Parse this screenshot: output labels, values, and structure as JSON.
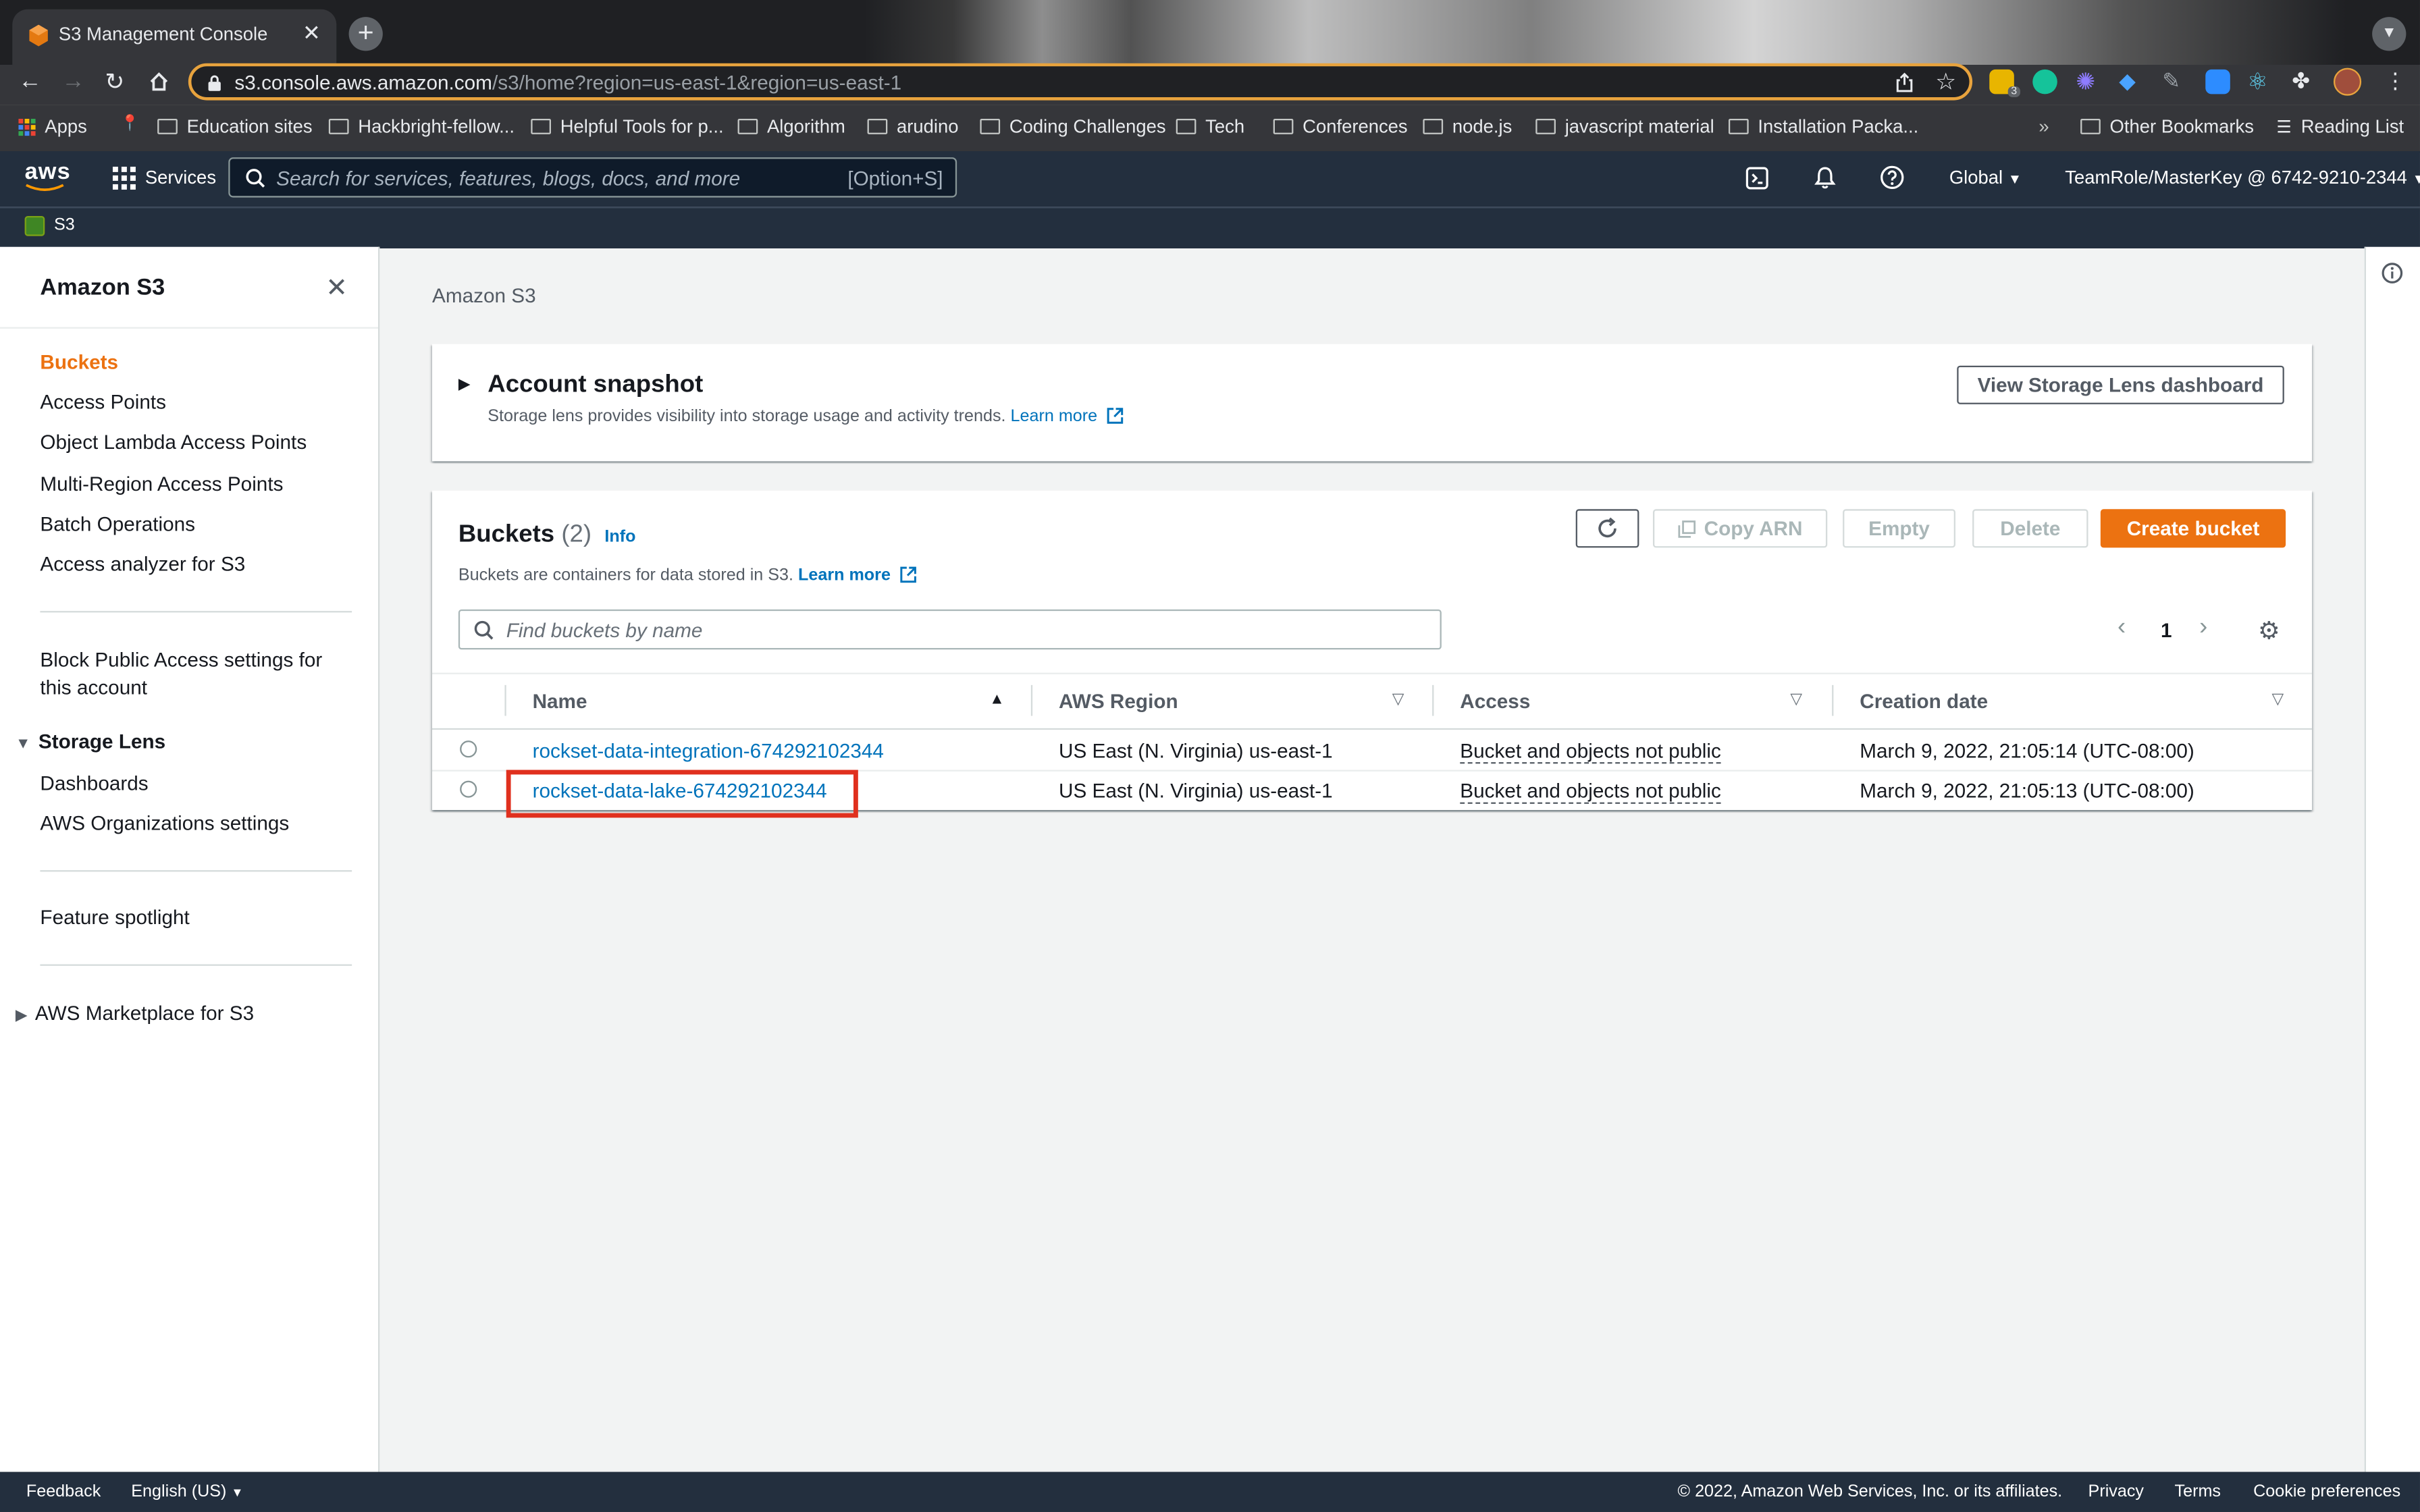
{
  "browser": {
    "tab_title": "S3 Management Console",
    "url_host": "s3.console.aws.amazon.com",
    "url_path": "/s3/home?region=us-east-1&region=us-east-1",
    "extension_badge": "3",
    "bookmarks": [
      {
        "label": "Apps",
        "icon": "apps-grid-icon"
      },
      {
        "label": "",
        "icon": "pin-icon"
      },
      {
        "label": "Education sites",
        "icon": "folder-icon"
      },
      {
        "label": "Hackbright-fellow...",
        "icon": "folder-icon"
      },
      {
        "label": "Helpful Tools for p...",
        "icon": "folder-icon"
      },
      {
        "label": "Algorithm",
        "icon": "folder-icon"
      },
      {
        "label": "arudino",
        "icon": "folder-icon"
      },
      {
        "label": "Coding Challenges",
        "icon": "folder-icon"
      },
      {
        "label": "Tech",
        "icon": "folder-icon"
      },
      {
        "label": "Conferences",
        "icon": "folder-icon"
      },
      {
        "label": "node.js",
        "icon": "folder-icon"
      },
      {
        "label": "javascript material",
        "icon": "folder-icon"
      },
      {
        "label": "Installation Packa...",
        "icon": "folder-icon"
      }
    ],
    "more_bookmarks": "»",
    "other_bookmarks": "Other Bookmarks",
    "reading_list": "Reading List"
  },
  "aws_nav": {
    "logo": "aws",
    "services": "Services",
    "search_placeholder": "Search for services, features, blogs, docs, and more",
    "search_shortcut": "[Option+S]",
    "region": "Global",
    "account": "TeamRole/MasterKey @ 6742-9210-2344",
    "service_tag": "S3"
  },
  "sidebar": {
    "title": "Amazon S3",
    "items": [
      "Buckets",
      "Access Points",
      "Object Lambda Access Points",
      "Multi-Region Access Points",
      "Batch Operations",
      "Access analyzer for S3"
    ],
    "block_public_1": "Block Public Access settings for",
    "block_public_2": "this account",
    "storage_lens": "Storage Lens",
    "storage_lens_items": [
      "Dashboards",
      "AWS Organizations settings"
    ],
    "feature_spotlight": "Feature spotlight",
    "marketplace": "AWS Marketplace for S3"
  },
  "main": {
    "breadcrumb": "Amazon S3",
    "snapshot": {
      "title": "Account snapshot",
      "desc": "Storage lens provides visibility into storage usage and activity trends.",
      "learn_more": "Learn more",
      "button": "View Storage Lens dashboard"
    },
    "buckets": {
      "title": "Buckets",
      "count": "(2)",
      "info": "Info",
      "desc": "Buckets are containers for data stored in S3.",
      "learn_more": "Learn more",
      "copy_arn": "Copy ARN",
      "empty": "Empty",
      "delete": "Delete",
      "create": "Create bucket",
      "search_placeholder": "Find buckets by name",
      "page": "1",
      "columns": [
        "Name",
        "AWS Region",
        "Access",
        "Creation date"
      ],
      "rows": [
        {
          "name": "rockset-data-integration-674292102344",
          "region": "US East (N. Virginia) us-east-1",
          "access": "Bucket and objects not public",
          "created": "March 9, 2022, 21:05:14 (UTC-08:00)"
        },
        {
          "name": "rockset-data-lake-674292102344",
          "region": "US East (N. Virginia) us-east-1",
          "access": "Bucket and objects not public",
          "created": "March 9, 2022, 21:05:13 (UTC-08:00)"
        }
      ]
    }
  },
  "footer": {
    "feedback": "Feedback",
    "language": "English (US)",
    "copyright": "© 2022, Amazon Web Services, Inc. or its affiliates.",
    "privacy": "Privacy",
    "terms": "Terms",
    "cookie": "Cookie preferences"
  },
  "colors": {
    "aws_nav_bg": "#232f3e",
    "link": "#0073bb",
    "primary": "#ec7211",
    "highlight_box": "#e0301e"
  }
}
